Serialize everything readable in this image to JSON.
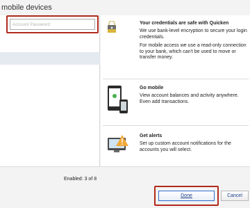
{
  "header": {
    "title": "mobile devices"
  },
  "password": {
    "placeholder": "Account Password",
    "value": ""
  },
  "security": {
    "title": "Your credentials are safe with Quicken",
    "line1": "We use bank-level encryption to secure your login credentials.",
    "line2": "For mobile access we use a read-only connection to your bank, which can't be used to move or transfer money."
  },
  "mobile": {
    "title": "Go mobile",
    "line1": "View account balances and activity anywhere.",
    "line2": "Even add transactions."
  },
  "alerts": {
    "title": "Get alerts",
    "line1": "Set up custom account notifications for the accounts you will select."
  },
  "footer": {
    "enabled": "Enabled: 3 of 8",
    "done_label": "Done",
    "cancel_label": "Cancel"
  },
  "icons": {
    "lock": "lock-icon",
    "phone": "phone-icon",
    "alert": "alert-icon"
  },
  "colors": {
    "highlight": "#b02a1b",
    "button_border": "#2f6fd0"
  }
}
